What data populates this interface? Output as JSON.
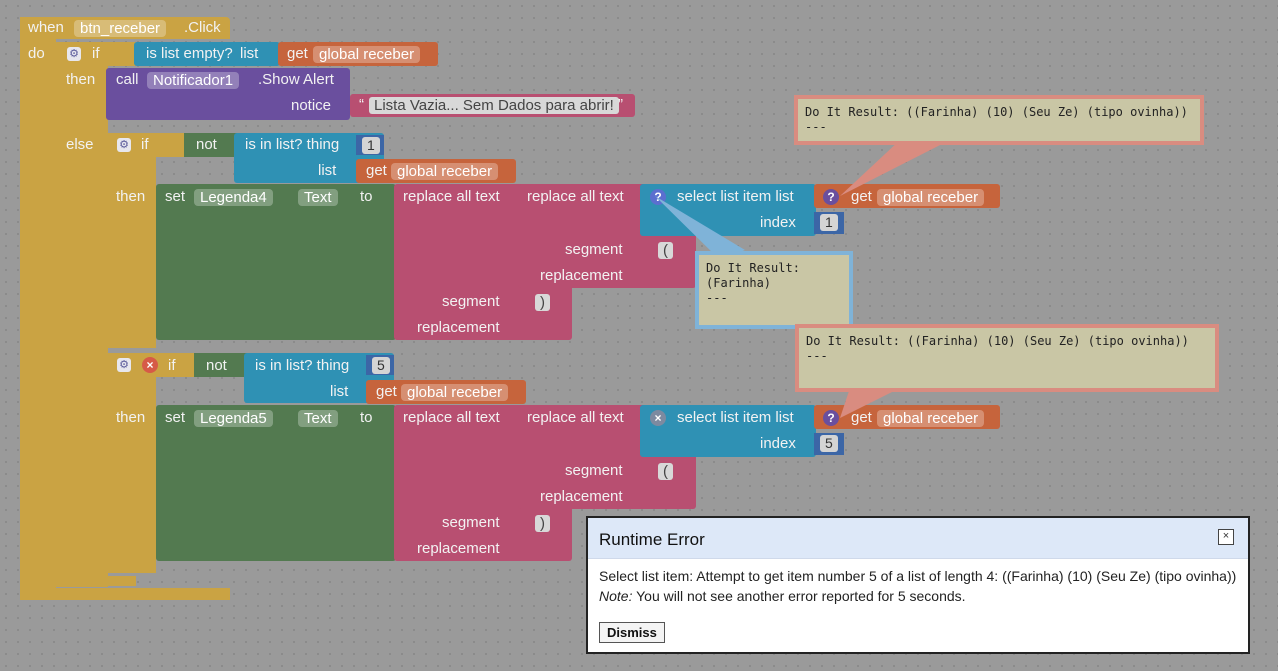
{
  "event": {
    "when": "when",
    "component": "btn_receber",
    "event_name": ".Click",
    "do": "do"
  },
  "if1": {
    "if": "if",
    "is_list_empty": "is list empty?",
    "list": "list",
    "get": "get",
    "var": "global receber",
    "then": "then",
    "else": "else"
  },
  "call": {
    "call": "call",
    "component": "Notificador1",
    "method": ".Show Alert",
    "notice": "notice",
    "text": "Lista Vazia... Sem Dados para abrir!"
  },
  "if2": {
    "if": "if",
    "not": "not",
    "is_in_list": "is in list? thing",
    "thing": "1",
    "list": "list",
    "get": "get",
    "var": "global receber",
    "then": "then"
  },
  "set1": {
    "set": "set",
    "component": "Legenda4",
    "prop": "Text",
    "to": "to"
  },
  "replace": {
    "replace_all": "replace all text",
    "segment": "segment",
    "replacement": "replacement",
    "seg_open": "(",
    "seg_close": ")",
    "blank": " "
  },
  "select1": {
    "label": "select list item  list",
    "get": "get",
    "var": "global receber",
    "index": "index",
    "index_value": "1"
  },
  "if3": {
    "if": "if",
    "not": "not",
    "is_in_list": "is in list? thing",
    "thing": "5",
    "list": "list",
    "get": "get",
    "var": "global receber",
    "then": "then"
  },
  "set2": {
    "set": "set",
    "component": "Legenda5",
    "prop": "Text",
    "to": "to"
  },
  "select2": {
    "label": "select list item  list",
    "get": "get",
    "var": "global receber",
    "index": "index",
    "index_value": "5"
  },
  "bubbles": {
    "top": "Do It Result: ((Farinha) (10) (Seu Ze) (tipo ovinha))\n---",
    "mid": "Do It Result:\n(Farinha)\n---",
    "low": "Do It Result: ((Farinha) (10) (Seu Ze) (tipo ovinha))\n---"
  },
  "dialog": {
    "title": "Runtime Error",
    "message": "Select list item: Attempt to get item number 5 of a list of length 4: ((Farinha) (10) (Seu Ze) (tipo ovinha))",
    "note_label": "Note:",
    "note_text": " You will not see another error reported for 5 seconds.",
    "dismiss": "Dismiss",
    "close": "×"
  }
}
